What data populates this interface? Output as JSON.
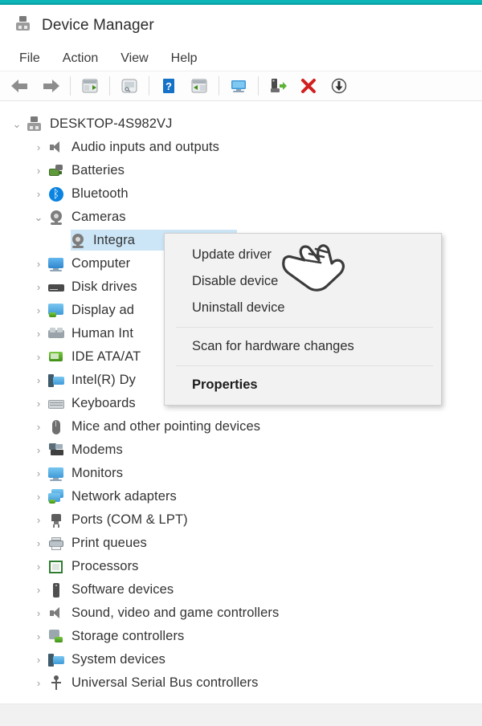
{
  "window": {
    "title": "Device Manager",
    "title_icon": "device-manager-icon",
    "accent_color": "#0cb6b8"
  },
  "menubar": {
    "items": [
      {
        "label": "File"
      },
      {
        "label": "Action"
      },
      {
        "label": "View"
      },
      {
        "label": "Help"
      }
    ]
  },
  "toolbar": {
    "buttons": [
      {
        "name": "back-arrow-icon",
        "tooltip": "Back"
      },
      {
        "name": "forward-arrow-icon",
        "tooltip": "Forward"
      },
      {
        "name": "properties-icon",
        "tooltip": "Properties"
      },
      {
        "name": "scan-icon",
        "tooltip": "Scan"
      },
      {
        "name": "help-icon",
        "tooltip": "Help"
      },
      {
        "name": "update-driver-icon",
        "tooltip": "Update driver"
      },
      {
        "name": "show-devices-icon",
        "tooltip": "Show devices"
      },
      {
        "name": "add-device-icon",
        "tooltip": "Add legacy hardware"
      },
      {
        "name": "remove-device-icon",
        "tooltip": "Uninstall device"
      },
      {
        "name": "download-icon",
        "tooltip": "Update"
      }
    ]
  },
  "tree": {
    "root": {
      "label": "DESKTOP-4S982VJ",
      "icon": "computer-icon",
      "expanded": true
    },
    "nodes": [
      {
        "label": "Audio inputs and outputs",
        "icon": "speaker-icon",
        "expanded": false,
        "selected": false
      },
      {
        "label": "Batteries",
        "icon": "battery-icon",
        "expanded": false,
        "selected": false
      },
      {
        "label": "Bluetooth",
        "icon": "bluetooth-icon",
        "expanded": false,
        "selected": false
      },
      {
        "label": "Cameras",
        "icon": "camera-icon",
        "expanded": true,
        "selected": false
      },
      {
        "label": "Integra",
        "icon": "camera-icon",
        "expanded": null,
        "selected": true,
        "child": true
      },
      {
        "label": "Computer",
        "icon": "monitor-icon",
        "expanded": false,
        "selected": false
      },
      {
        "label": "Disk drives",
        "icon": "disk-drive-icon",
        "expanded": false,
        "selected": false
      },
      {
        "label": "Display ad",
        "icon": "display-adapter-icon",
        "expanded": false,
        "selected": false
      },
      {
        "label": "Human Int",
        "icon": "hid-icon",
        "expanded": false,
        "selected": false
      },
      {
        "label": "IDE ATA/AT",
        "icon": "ide-controller-icon",
        "expanded": false,
        "selected": false
      },
      {
        "label": "Intel(R) Dy",
        "icon": "intel-device-icon",
        "expanded": false,
        "selected": false
      },
      {
        "label": "Keyboards",
        "icon": "keyboard-icon",
        "expanded": false,
        "selected": false
      },
      {
        "label": "Mice and other pointing devices",
        "icon": "mouse-icon",
        "expanded": false,
        "selected": false
      },
      {
        "label": "Modems",
        "icon": "modem-icon",
        "expanded": false,
        "selected": false
      },
      {
        "label": "Monitors",
        "icon": "monitor-icon",
        "expanded": false,
        "selected": false
      },
      {
        "label": "Network adapters",
        "icon": "network-adapter-icon",
        "expanded": false,
        "selected": false
      },
      {
        "label": "Ports (COM & LPT)",
        "icon": "port-icon",
        "expanded": false,
        "selected": false
      },
      {
        "label": "Print queues",
        "icon": "printer-icon",
        "expanded": false,
        "selected": false
      },
      {
        "label": "Processors",
        "icon": "processor-icon",
        "expanded": false,
        "selected": false
      },
      {
        "label": "Software devices",
        "icon": "software-device-icon",
        "expanded": false,
        "selected": false
      },
      {
        "label": "Sound, video and game controllers",
        "icon": "speaker-icon",
        "expanded": false,
        "selected": false
      },
      {
        "label": "Storage controllers",
        "icon": "storage-controller-icon",
        "expanded": false,
        "selected": false
      },
      {
        "label": "System devices",
        "icon": "system-device-icon",
        "expanded": false,
        "selected": false
      },
      {
        "label": "Universal Serial Bus controllers",
        "icon": "usb-icon",
        "expanded": false,
        "selected": false
      }
    ],
    "selection_color": "#cce6f7"
  },
  "context_menu": {
    "items": [
      {
        "label": "Update driver",
        "bold": false,
        "type": "item"
      },
      {
        "label": "Disable device",
        "bold": false,
        "type": "item"
      },
      {
        "label": "Uninstall device",
        "bold": false,
        "type": "item"
      },
      {
        "type": "separator"
      },
      {
        "label": "Scan for hardware changes",
        "bold": false,
        "type": "item"
      },
      {
        "type": "separator"
      },
      {
        "label": "Properties",
        "bold": true,
        "type": "item"
      }
    ]
  },
  "cursor": {
    "type": "pointing-hand-cursor",
    "pointing_at": "Update driver"
  }
}
